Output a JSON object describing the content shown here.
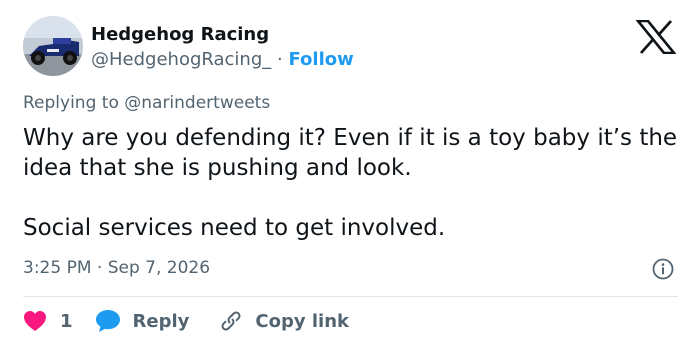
{
  "author": {
    "name": "Hedgehog Racing",
    "handle": "@HedgehogRacing_",
    "separator": "·",
    "follow_label": "Follow"
  },
  "tweet": {
    "reply_prefix": "Replying to",
    "reply_to": "@narindertweets",
    "paragraphs": [
      "Why are you defending it? Even if it is a toy baby it’s the idea that she is pushing and look.",
      "Social services need to get involved."
    ],
    "time": "3:25 PM",
    "meta_separator": "·",
    "date": "Sep 7, 2026"
  },
  "actions": {
    "like_count": "1",
    "reply_label": "Reply",
    "copy_link_label": "Copy link"
  },
  "colors": {
    "accent": "#1d9bf0",
    "like": "#f91880",
    "muted": "#536471",
    "text": "#0f1419"
  },
  "icons": {
    "logo": "x-logo-icon",
    "info": "info-icon",
    "like": "heart-icon",
    "reply": "speech-bubble-icon",
    "copy": "link-icon"
  }
}
